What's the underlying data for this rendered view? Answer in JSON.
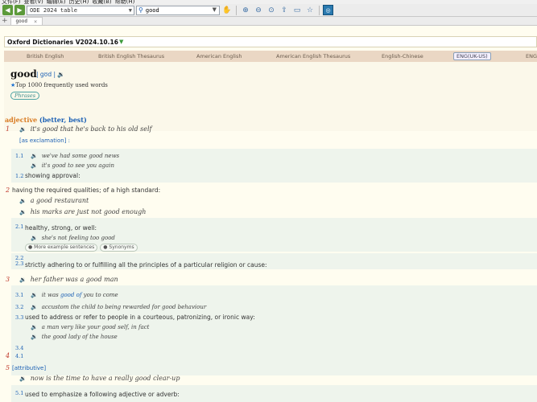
{
  "menu": [
    "文件(F)",
    "查看(V)",
    "编辑(E)",
    "历史(H)",
    "收藏(B)",
    "帮助(H)"
  ],
  "toolbar": {
    "dict_select_value": "ODE 2024 table",
    "search_value": "good"
  },
  "tabs": [
    {
      "label": "good"
    }
  ],
  "dictionary": {
    "title": "Oxford Dictionaries V2024.10.16",
    "lang_tabs": [
      "British English",
      "British English Thesaurus",
      "American English",
      "American English Thesaurus",
      "English-Chinese",
      "ENG(UK-US)",
      "ENG("
    ],
    "active_lang_tab": "ENG(UK-US)"
  },
  "entry": {
    "headword": "good",
    "pronunciation": "gʊd",
    "frequency": "Top 1000 frequently used words",
    "phrases_label": "Phrases",
    "pos": "adjective",
    "forms_open": "(",
    "form1": "better",
    "comma": ",",
    "form2": "best",
    "forms_close": ")"
  },
  "senses": {
    "s1_num": "1",
    "s1_ex": "it's good that he's back to his old self",
    "s1_tag": "[as exclamation] :",
    "s11_num": "1.1",
    "s11_ex1": "we've had some good news",
    "s11_ex2": "it's good to see you again",
    "s12_num": "1.2",
    "s12_def": "showing approval:",
    "s2_num": "2",
    "s2_def": "having the required qualities; of a high standard:",
    "s2_ex1": "a good restaurant",
    "s2_ex2": "his marks are just not good enough",
    "s21_num": "2.1",
    "s21_def": "healthy, strong, or well:",
    "s21_ex1": "she's not feeling too good",
    "pill_examples": "More example sentences",
    "pill_synonyms": "Synonyms",
    "s22_num": "2.2",
    "s23_num": "2.3",
    "s23_def": "strictly adhering to or fulfilling all the principles of a particular religion or cause:",
    "s3_num": "3",
    "s3_ex": "her father was a good man",
    "s31_num": "3.1",
    "s31_ex_a": "it was ",
    "s31_ex_b": "good of",
    "s31_ex_c": " you to come",
    "s32_num": "3.2",
    "s32_ex": "accustom the child to being rewarded for good behaviour",
    "s33_num": "3.3",
    "s33_def": "used to address or refer to people in a courteous, patronizing, or ironic way:",
    "s33_ex1": "a man very like your good self, in fact",
    "s33_ex2": "the good lady of the house",
    "s34_num": "3.4",
    "s4_num": "4",
    "s41_num": "4.1",
    "s5_num": "5",
    "s5_tag": "[attributive]",
    "s5_ex": "now is the time to have a really good clear-up",
    "s51_num": "5.1",
    "s51_def": "used to emphasize a following adjective or adverb:"
  }
}
